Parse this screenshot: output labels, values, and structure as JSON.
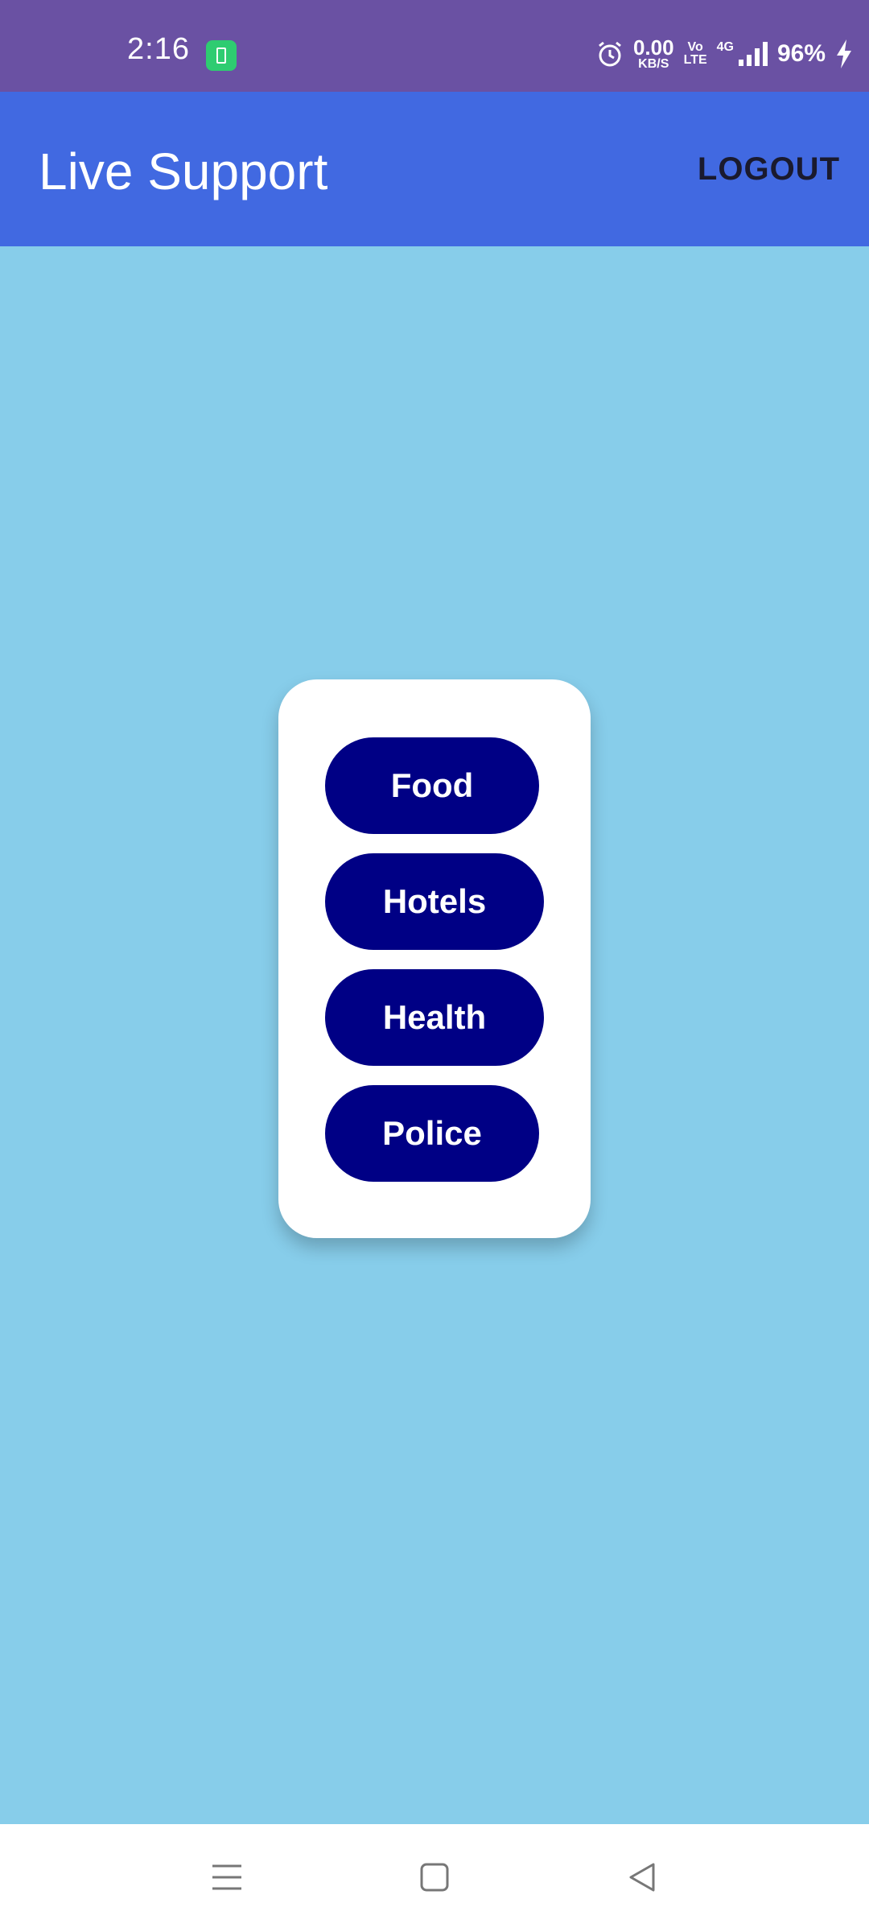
{
  "status_bar": {
    "time": "2:16",
    "speed_value": "0.00",
    "speed_unit": "KB/S",
    "volte_top": "Vo",
    "volte_bottom": "LTE",
    "network": "4G",
    "battery": "96%"
  },
  "app_bar": {
    "title": "Live Support",
    "logout_label": "LOGOUT"
  },
  "menu": {
    "buttons": [
      {
        "label": "Food"
      },
      {
        "label": "Hotels"
      },
      {
        "label": "Health"
      },
      {
        "label": "Police"
      }
    ]
  },
  "colors": {
    "status_bar": "#6A51A3",
    "app_bar": "#4169E1",
    "background": "#87CDEA",
    "button": "#000085"
  },
  "icons": [
    "app-notification-icon",
    "alarm-icon",
    "signal-icon",
    "charging-icon",
    "menu-icon",
    "home-icon",
    "back-icon"
  ]
}
